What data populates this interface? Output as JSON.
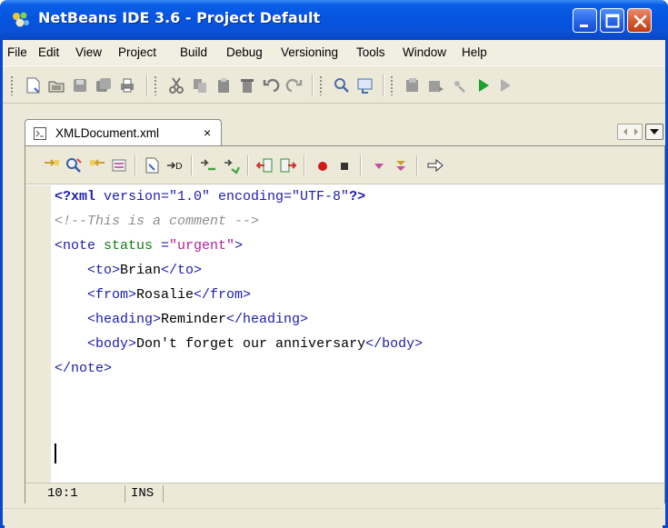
{
  "window": {
    "title": "NetBeans IDE 3.6 - Project Default"
  },
  "menu": [
    "File",
    "Edit",
    "View",
    "Project",
    "Build",
    "Debug",
    "Versioning",
    "Tools",
    "Window",
    "Help"
  ],
  "main_toolbar": {
    "icons": [
      "new-file-icon",
      "open-project-icon",
      "save-icon",
      "save-all-icon",
      "print-icon",
      "cut-icon",
      "copy-icon",
      "paste-icon",
      "delete-icon",
      "undo-icon",
      "redo-icon",
      "find-icon",
      "go-to-icon",
      "compile-icon",
      "build-icon",
      "debug-icon",
      "run-icon",
      "continue-icon"
    ]
  },
  "editor_tab": {
    "label": "XMLDocument.xml",
    "close": "×"
  },
  "editor_toolbar": {
    "icons": [
      "find-previous-icon",
      "find-icon",
      "find-next-icon",
      "toggle-highlight-icon",
      "find-selection-icon",
      "go-to-line-icon",
      "shift-left-icon",
      "shift-right-icon",
      "comment-icon",
      "uncomment-icon",
      "record-macro-icon",
      "stop-macro-icon",
      "previous-bookmark-icon",
      "next-bookmark-icon",
      "go-to-source-icon"
    ]
  },
  "code_lines": [
    [
      {
        "t": "pi",
        "s": "<?xml"
      },
      {
        "t": "tag",
        "s": " version=\"1.0\" encoding=\"UTF-8\""
      },
      {
        "t": "pi",
        "s": "?>"
      }
    ],
    [
      {
        "t": "com",
        "s": "<!--This is a comment -->"
      }
    ],
    [
      {
        "t": "tag",
        "s": "<note"
      },
      {
        "t": "attr",
        "s": " status "
      },
      {
        "t": "tag",
        "s": "="
      },
      {
        "t": "val",
        "s": "\"urgent\""
      },
      {
        "t": "tag",
        "s": ">"
      }
    ],
    [
      {
        "t": "text",
        "s": "    "
      },
      {
        "t": "tag",
        "s": "<to>"
      },
      {
        "t": "text",
        "s": "Brian"
      },
      {
        "t": "tag",
        "s": "</to>"
      }
    ],
    [
      {
        "t": "text",
        "s": "    "
      },
      {
        "t": "tag",
        "s": "<from>"
      },
      {
        "t": "text",
        "s": "Rosalie"
      },
      {
        "t": "tag",
        "s": "</from>"
      }
    ],
    [
      {
        "t": "text",
        "s": "    "
      },
      {
        "t": "tag",
        "s": "<heading>"
      },
      {
        "t": "text",
        "s": "Reminder"
      },
      {
        "t": "tag",
        "s": "</heading>"
      }
    ],
    [
      {
        "t": "text",
        "s": "    "
      },
      {
        "t": "tag",
        "s": "<body>"
      },
      {
        "t": "text",
        "s": "Don't forget our anniversary"
      },
      {
        "t": "tag",
        "s": "</body>"
      }
    ],
    [
      {
        "t": "tag",
        "s": "</note>"
      }
    ]
  ],
  "status": {
    "position": "10:1",
    "mode": "INS"
  },
  "colors": {
    "titlebar": "#0554e0",
    "tag": "#1c1cb0",
    "attribute": "#157a15",
    "value": "#b41e9b",
    "comment": "#8f8f8f"
  }
}
